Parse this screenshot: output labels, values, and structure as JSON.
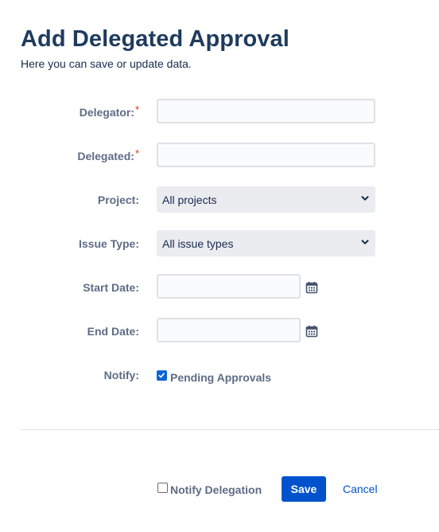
{
  "header": {
    "title": "Add Delegated Approval",
    "subtitle": "Here you can save or update data."
  },
  "form": {
    "delegator": {
      "label": "Delegator:",
      "required_mark": "*",
      "value": ""
    },
    "delegated": {
      "label": "Delegated:",
      "required_mark": "*",
      "value": ""
    },
    "project": {
      "label": "Project:",
      "selected": "All projects"
    },
    "issue_type": {
      "label": "Issue Type:",
      "selected": "All issue types"
    },
    "start_date": {
      "label": "Start Date:",
      "value": ""
    },
    "end_date": {
      "label": "End Date:",
      "value": ""
    },
    "notify": {
      "label": "Notify:",
      "option_label": "Pending Approvals",
      "checked": true
    }
  },
  "footer": {
    "notify_delegation_label": "Notify Delegation",
    "notify_delegation_checked": false,
    "save_label": "Save",
    "cancel_label": "Cancel"
  },
  "icons": {
    "calendar": "calendar-icon",
    "chevron": "chevron-down-icon",
    "check": "checkmark-icon"
  },
  "colors": {
    "title": "#1f3b5d",
    "label": "#5e6c84",
    "required": "#de350b",
    "primary": "#0052cc",
    "checkbox": "#0a66d6"
  }
}
